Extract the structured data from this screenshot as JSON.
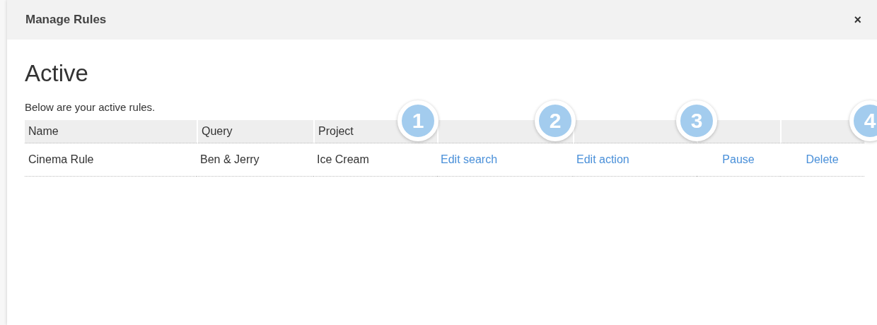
{
  "dialog": {
    "title": "Manage Rules",
    "close": "×"
  },
  "heading": "Active",
  "description": "Below are your active rules.",
  "table": {
    "columns": [
      {
        "label": "Name"
      },
      {
        "label": "Query"
      },
      {
        "label": "Project"
      }
    ],
    "rows": [
      {
        "cells": [
          {
            "kind": "text",
            "text": "Cinema Rule"
          },
          {
            "kind": "text",
            "text": "Ben & Jerry"
          },
          {
            "kind": "text",
            "text": "Ice Cream"
          },
          {
            "kind": "link",
            "text": "Edit search"
          },
          {
            "kind": "link",
            "text": "Edit action"
          },
          {
            "kind": "link",
            "text": "Pause"
          },
          {
            "kind": "link",
            "text": "Delete"
          }
        ]
      }
    ]
  },
  "callouts": [
    "1",
    "2",
    "3",
    "4"
  ]
}
